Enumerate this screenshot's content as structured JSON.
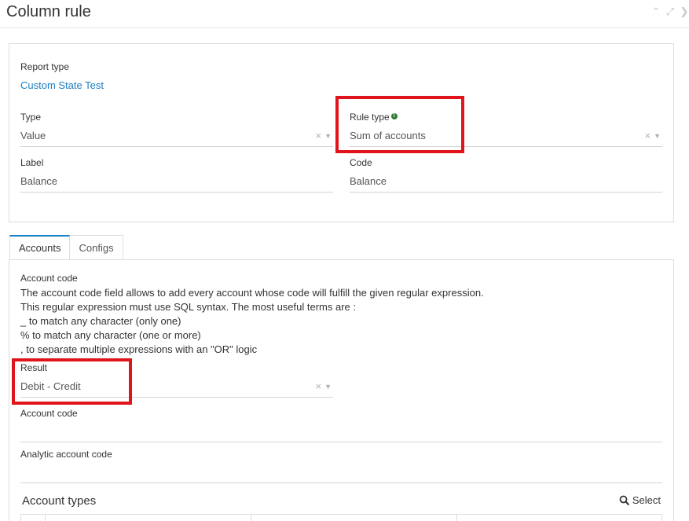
{
  "window": {
    "title": "Column rule",
    "icons": [
      "chevron-up-icon",
      "expand-icon",
      "close-icon"
    ]
  },
  "form": {
    "report_type_label": "Report type",
    "report_type_value": "Custom State Test",
    "type_label": "Type",
    "type_value": "Value",
    "rule_type_label": "Rule type",
    "rule_type_value": "Sum of accounts",
    "label_label": "Label",
    "label_value": "Balance",
    "code_label": "Code",
    "code_value": "Balance"
  },
  "tabs": [
    {
      "label": "Accounts",
      "active": true
    },
    {
      "label": "Configs",
      "active": false
    }
  ],
  "accounts": {
    "account_code_title": "Account code",
    "help_lines": [
      "The account code field allows to add every account whose code will fulfill the given regular expression.",
      "This regular expression must use SQL syntax. The most useful terms are :",
      "_ to match any character (only one)",
      "% to match any character (one or more)",
      ", to separate multiple expressions with an \"OR\" logic"
    ],
    "result_label": "Result",
    "result_value": "Debit - Credit",
    "account_code_label": "Account code",
    "account_code_value": "",
    "analytic_label": "Analytic account code",
    "analytic_value": "",
    "account_types_title": "Account types",
    "select_label": "Select"
  },
  "colors": {
    "accent": "#1a7fc2",
    "highlight": "#e0141b",
    "info": "#2e7d32"
  }
}
